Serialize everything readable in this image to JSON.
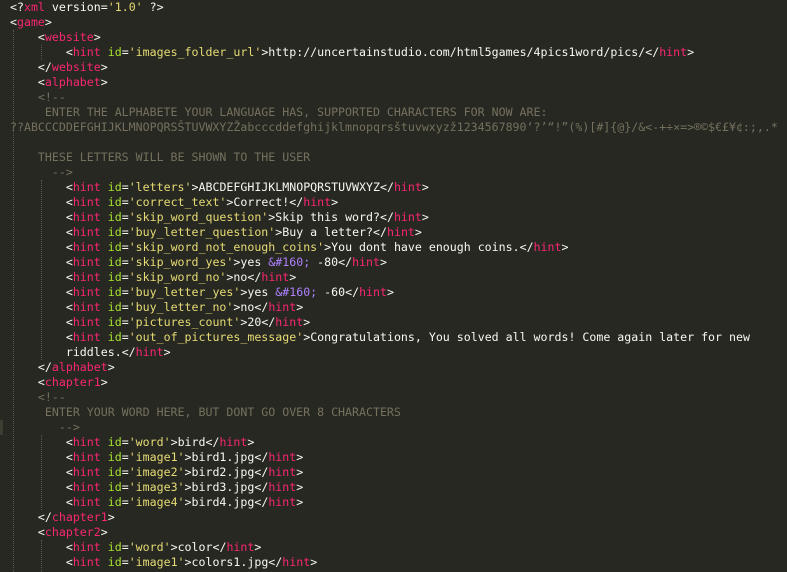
{
  "editor": {
    "lines": [
      [
        [
          "p",
          "<?"
        ],
        [
          "t",
          "xml"
        ],
        [
          "x",
          " version="
        ],
        [
          "s",
          "'1.0'"
        ],
        [
          "x",
          " "
        ],
        [
          "p",
          "?>"
        ]
      ],
      [
        [
          "p",
          "<"
        ],
        [
          "t",
          "game"
        ],
        [
          "p",
          ">"
        ]
      ],
      [
        [
          "x",
          "    "
        ],
        [
          "p",
          "<"
        ],
        [
          "t",
          "website"
        ],
        [
          "p",
          ">"
        ]
      ],
      [
        [
          "x",
          "        "
        ],
        [
          "p",
          "<"
        ],
        [
          "t",
          "hint"
        ],
        [
          "x",
          " "
        ],
        [
          "a",
          "id"
        ],
        [
          "x",
          "="
        ],
        [
          "s",
          "'images_folder_url'"
        ],
        [
          "p",
          ">"
        ],
        [
          "x",
          "http://uncertainstudio.com/html5games/4pics1word/pics/"
        ],
        [
          "p",
          "</"
        ],
        [
          "t",
          "hint"
        ],
        [
          "p",
          ">"
        ]
      ],
      [
        [
          "x",
          "    "
        ],
        [
          "p",
          "</"
        ],
        [
          "t",
          "website"
        ],
        [
          "p",
          ">"
        ]
      ],
      [
        [
          "x",
          "    "
        ],
        [
          "p",
          "<"
        ],
        [
          "t",
          "alphabet"
        ],
        [
          "p",
          ">"
        ]
      ],
      [
        [
          "c",
          "    <!--"
        ]
      ],
      [
        [
          "c",
          "     ENTER THE ALPHABETE YOUR LANGUAGE HAS, SUPPORTED CHARACTERS FOR NOW ARE:"
        ]
      ],
      [
        [
          "c",
          "??ABCCCDDEFGHIJKLMNOPQRSŠTUVWXYZŽabcccddefghijklmnopqrsštuvwxyzž1234567890‘?’“!”(%)[#]{@}/&<-+÷×=>®©$€£¥¢:;,.*"
        ]
      ],
      [
        [
          "x",
          ""
        ]
      ],
      [
        [
          "c",
          "    THESE LETTERS WILL BE SHOWN TO THE USER"
        ]
      ],
      [
        [
          "c",
          "      -->"
        ]
      ],
      [
        [
          "x",
          "        "
        ],
        [
          "p",
          "<"
        ],
        [
          "t",
          "hint"
        ],
        [
          "x",
          " "
        ],
        [
          "a",
          "id"
        ],
        [
          "x",
          "="
        ],
        [
          "s",
          "'letters'"
        ],
        [
          "p",
          ">"
        ],
        [
          "x",
          "ABCDEFGHIJKLMNOPQRSTUVWXYZ"
        ],
        [
          "p",
          "</"
        ],
        [
          "t",
          "hint"
        ],
        [
          "p",
          ">"
        ]
      ],
      [
        [
          "x",
          "        "
        ],
        [
          "p",
          "<"
        ],
        [
          "t",
          "hint"
        ],
        [
          "x",
          " "
        ],
        [
          "a",
          "id"
        ],
        [
          "x",
          "="
        ],
        [
          "s",
          "'correct_text'"
        ],
        [
          "p",
          ">"
        ],
        [
          "x",
          "Correct!"
        ],
        [
          "p",
          "</"
        ],
        [
          "t",
          "hint"
        ],
        [
          "p",
          ">"
        ]
      ],
      [
        [
          "x",
          "        "
        ],
        [
          "p",
          "<"
        ],
        [
          "t",
          "hint"
        ],
        [
          "x",
          " "
        ],
        [
          "a",
          "id"
        ],
        [
          "x",
          "="
        ],
        [
          "s",
          "'skip_word_question'"
        ],
        [
          "p",
          ">"
        ],
        [
          "x",
          "Skip this word?"
        ],
        [
          "p",
          "</"
        ],
        [
          "t",
          "hint"
        ],
        [
          "p",
          ">"
        ]
      ],
      [
        [
          "x",
          "        "
        ],
        [
          "p",
          "<"
        ],
        [
          "t",
          "hint"
        ],
        [
          "x",
          " "
        ],
        [
          "a",
          "id"
        ],
        [
          "x",
          "="
        ],
        [
          "s",
          "'buy_letter_question'"
        ],
        [
          "p",
          ">"
        ],
        [
          "x",
          "Buy a letter?"
        ],
        [
          "p",
          "</"
        ],
        [
          "t",
          "hint"
        ],
        [
          "p",
          ">"
        ]
      ],
      [
        [
          "x",
          "        "
        ],
        [
          "p",
          "<"
        ],
        [
          "t",
          "hint"
        ],
        [
          "x",
          " "
        ],
        [
          "a",
          "id"
        ],
        [
          "x",
          "="
        ],
        [
          "s",
          "'skip_word_not_enough_coins'"
        ],
        [
          "p",
          ">"
        ],
        [
          "x",
          "You dont have enough coins."
        ],
        [
          "p",
          "</"
        ],
        [
          "t",
          "hint"
        ],
        [
          "p",
          ">"
        ]
      ],
      [
        [
          "x",
          "        "
        ],
        [
          "p",
          "<"
        ],
        [
          "t",
          "hint"
        ],
        [
          "x",
          " "
        ],
        [
          "a",
          "id"
        ],
        [
          "x",
          "="
        ],
        [
          "s",
          "'skip_word_yes'"
        ],
        [
          "p",
          ">"
        ],
        [
          "x",
          "yes "
        ],
        [
          "e",
          "&#160;"
        ],
        [
          "x",
          " -80"
        ],
        [
          "p",
          "</"
        ],
        [
          "t",
          "hint"
        ],
        [
          "p",
          ">"
        ]
      ],
      [
        [
          "x",
          "        "
        ],
        [
          "p",
          "<"
        ],
        [
          "t",
          "hint"
        ],
        [
          "x",
          " "
        ],
        [
          "a",
          "id"
        ],
        [
          "x",
          "="
        ],
        [
          "s",
          "'skip_word_no'"
        ],
        [
          "p",
          ">"
        ],
        [
          "x",
          "no"
        ],
        [
          "p",
          "</"
        ],
        [
          "t",
          "hint"
        ],
        [
          "p",
          ">"
        ]
      ],
      [
        [
          "x",
          "        "
        ],
        [
          "p",
          "<"
        ],
        [
          "t",
          "hint"
        ],
        [
          "x",
          " "
        ],
        [
          "a",
          "id"
        ],
        [
          "x",
          "="
        ],
        [
          "s",
          "'buy_letter_yes'"
        ],
        [
          "p",
          ">"
        ],
        [
          "x",
          "yes "
        ],
        [
          "e",
          "&#160;"
        ],
        [
          "x",
          " -60"
        ],
        [
          "p",
          "</"
        ],
        [
          "t",
          "hint"
        ],
        [
          "p",
          ">"
        ]
      ],
      [
        [
          "x",
          "        "
        ],
        [
          "p",
          "<"
        ],
        [
          "t",
          "hint"
        ],
        [
          "x",
          " "
        ],
        [
          "a",
          "id"
        ],
        [
          "x",
          "="
        ],
        [
          "s",
          "'buy_letter_no'"
        ],
        [
          "p",
          ">"
        ],
        [
          "x",
          "no"
        ],
        [
          "p",
          "</"
        ],
        [
          "t",
          "hint"
        ],
        [
          "p",
          ">"
        ]
      ],
      [
        [
          "x",
          "        "
        ],
        [
          "p",
          "<"
        ],
        [
          "t",
          "hint"
        ],
        [
          "x",
          " "
        ],
        [
          "a",
          "id"
        ],
        [
          "x",
          "="
        ],
        [
          "s",
          "'pictures_count'"
        ],
        [
          "p",
          ">"
        ],
        [
          "x",
          "20"
        ],
        [
          "p",
          "</"
        ],
        [
          "t",
          "hint"
        ],
        [
          "p",
          ">"
        ]
      ],
      [
        [
          "x",
          "        "
        ],
        [
          "p",
          "<"
        ],
        [
          "t",
          "hint"
        ],
        [
          "x",
          " "
        ],
        [
          "a",
          "id"
        ],
        [
          "x",
          "="
        ],
        [
          "s",
          "'out_of_pictures_message'"
        ],
        [
          "p",
          ">"
        ],
        [
          "x",
          "Congratulations, You solved all words! Come again later for new"
        ]
      ],
      [
        [
          "x",
          "        riddles."
        ],
        [
          "p",
          "</"
        ],
        [
          "t",
          "hint"
        ],
        [
          "p",
          ">"
        ]
      ],
      [
        [
          "x",
          "    "
        ],
        [
          "p",
          "</"
        ],
        [
          "t",
          "alphabet"
        ],
        [
          "p",
          ">"
        ]
      ],
      [
        [
          "x",
          "    "
        ],
        [
          "p",
          "<"
        ],
        [
          "t",
          "chapter1"
        ],
        [
          "p",
          ">"
        ]
      ],
      [
        [
          "c",
          "    <!--"
        ]
      ],
      [
        [
          "c",
          "     ENTER YOUR WORD HERE, BUT DONT GO OVER 8 CHARACTERS"
        ]
      ],
      [
        [
          "c",
          "       -->"
        ]
      ],
      [
        [
          "x",
          "        "
        ],
        [
          "p",
          "<"
        ],
        [
          "t",
          "hint"
        ],
        [
          "x",
          " "
        ],
        [
          "a",
          "id"
        ],
        [
          "x",
          "="
        ],
        [
          "s",
          "'word'"
        ],
        [
          "p",
          ">"
        ],
        [
          "x",
          "bird"
        ],
        [
          "p",
          "</"
        ],
        [
          "t",
          "hint"
        ],
        [
          "p",
          ">"
        ]
      ],
      [
        [
          "x",
          "        "
        ],
        [
          "p",
          "<"
        ],
        [
          "t",
          "hint"
        ],
        [
          "x",
          " "
        ],
        [
          "a",
          "id"
        ],
        [
          "x",
          "="
        ],
        [
          "s",
          "'image1'"
        ],
        [
          "p",
          ">"
        ],
        [
          "x",
          "bird1.jpg"
        ],
        [
          "p",
          "</"
        ],
        [
          "t",
          "hint"
        ],
        [
          "p",
          ">"
        ]
      ],
      [
        [
          "x",
          "        "
        ],
        [
          "p",
          "<"
        ],
        [
          "t",
          "hint"
        ],
        [
          "x",
          " "
        ],
        [
          "a",
          "id"
        ],
        [
          "x",
          "="
        ],
        [
          "s",
          "'image2'"
        ],
        [
          "p",
          ">"
        ],
        [
          "x",
          "bird2.jpg"
        ],
        [
          "p",
          "</"
        ],
        [
          "t",
          "hint"
        ],
        [
          "p",
          ">"
        ]
      ],
      [
        [
          "x",
          "        "
        ],
        [
          "p",
          "<"
        ],
        [
          "t",
          "hint"
        ],
        [
          "x",
          " "
        ],
        [
          "a",
          "id"
        ],
        [
          "x",
          "="
        ],
        [
          "s",
          "'image3'"
        ],
        [
          "p",
          ">"
        ],
        [
          "x",
          "bird3.jpg"
        ],
        [
          "p",
          "</"
        ],
        [
          "t",
          "hint"
        ],
        [
          "p",
          ">"
        ]
      ],
      [
        [
          "x",
          "        "
        ],
        [
          "p",
          "<"
        ],
        [
          "t",
          "hint"
        ],
        [
          "x",
          " "
        ],
        [
          "a",
          "id"
        ],
        [
          "x",
          "="
        ],
        [
          "s",
          "'image4'"
        ],
        [
          "p",
          ">"
        ],
        [
          "x",
          "bird4.jpg"
        ],
        [
          "p",
          "</"
        ],
        [
          "t",
          "hint"
        ],
        [
          "p",
          ">"
        ]
      ],
      [
        [
          "x",
          "    "
        ],
        [
          "p",
          "</"
        ],
        [
          "t",
          "chapter1"
        ],
        [
          "p",
          ">"
        ]
      ],
      [
        [
          "x",
          "    "
        ],
        [
          "p",
          "<"
        ],
        [
          "t",
          "chapter2"
        ],
        [
          "p",
          ">"
        ]
      ],
      [
        [
          "x",
          "        "
        ],
        [
          "p",
          "<"
        ],
        [
          "t",
          "hint"
        ],
        [
          "x",
          " "
        ],
        [
          "a",
          "id"
        ],
        [
          "x",
          "="
        ],
        [
          "s",
          "'word'"
        ],
        [
          "p",
          ">"
        ],
        [
          "x",
          "color"
        ],
        [
          "p",
          "</"
        ],
        [
          "t",
          "hint"
        ],
        [
          "p",
          ">"
        ]
      ],
      [
        [
          "x",
          "        "
        ],
        [
          "p",
          "<"
        ],
        [
          "t",
          "hint"
        ],
        [
          "x",
          " "
        ],
        [
          "a",
          "id"
        ],
        [
          "x",
          "="
        ],
        [
          "s",
          "'image1'"
        ],
        [
          "p",
          ">"
        ],
        [
          "x",
          "colors1.jpg"
        ],
        [
          "p",
          "</"
        ],
        [
          "t",
          "hint"
        ],
        [
          "p",
          ">"
        ]
      ]
    ]
  },
  "theme": {
    "background": "#272822",
    "tag": "#f92672",
    "attribute": "#a6e22e",
    "string": "#e6db74",
    "text": "#f8f8f2",
    "comment": "#75715e",
    "entity": "#ae81ff"
  }
}
